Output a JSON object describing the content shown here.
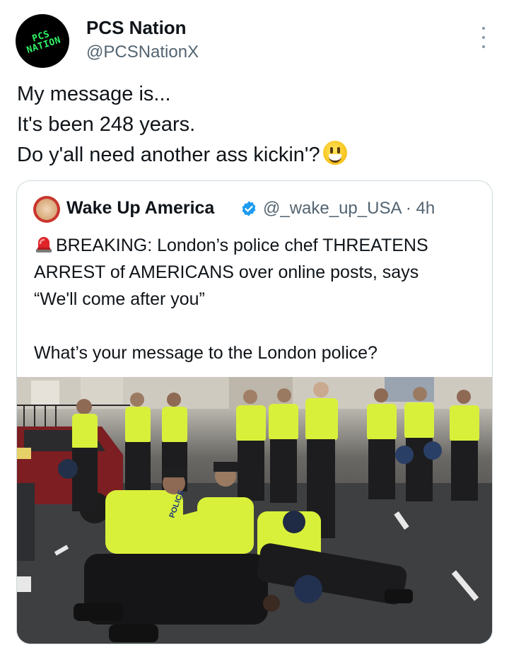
{
  "author": {
    "name": "PCS Nation",
    "handle": "@PCSNationX",
    "avatar_text": "PCS NATION"
  },
  "tweet": {
    "lines": [
      "My message is...",
      "It's been 248 years.",
      "Do y'all need another ass kickin'?"
    ],
    "emoji": "grinning-face-emoji"
  },
  "quoted": {
    "name": "Wake Up America",
    "handle_time": "@_wake_up_USA · 4h",
    "body_lines": [
      "BREAKING: London’s police chef THREATENS",
      "ARREST of AMERICANS over online posts, says",
      "“We'll come after you”"
    ],
    "question": "What’s your message to the London police?",
    "icons": [
      "police-siren-icon",
      "verified-badge-icon"
    ]
  },
  "media": {
    "vest_text": "POLICE"
  },
  "colors": {
    "secondary_text": "#536471",
    "border": "#cfd9de",
    "verified": "#1d9bf0",
    "hi_vis": "#d9f03a"
  }
}
